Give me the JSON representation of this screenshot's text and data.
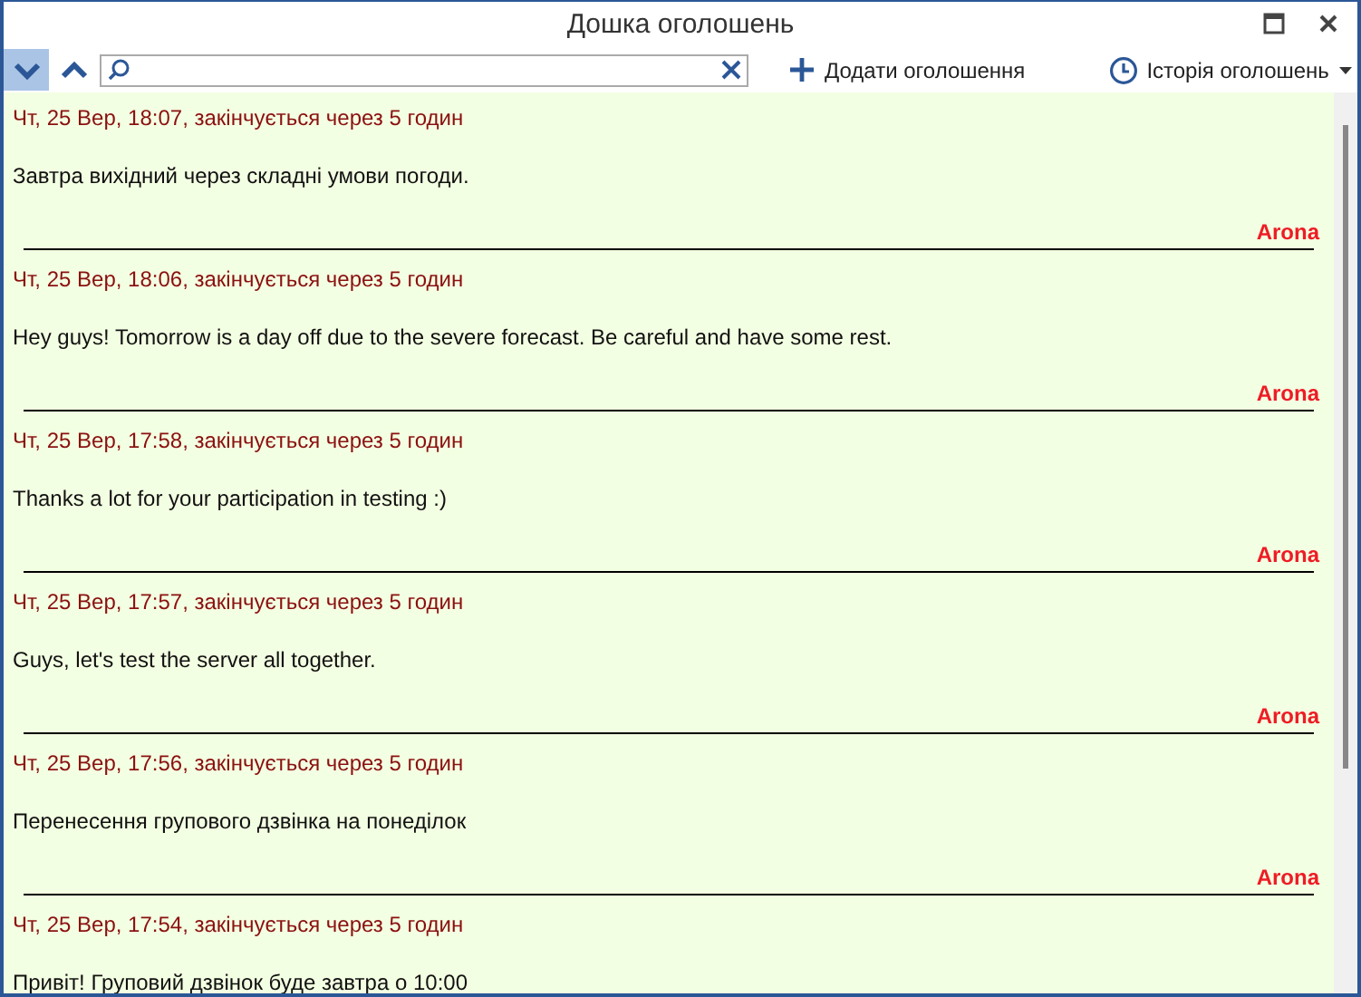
{
  "window": {
    "title": "Дошка оголошень"
  },
  "toolbar": {
    "add_button": "Додати оголошення",
    "history_button": "Історія оголошень",
    "expand_selected": true
  },
  "messages": [
    {
      "header": "Чт, 25 Вер, 18:07, закінчується через 5 годин",
      "text": "Завтра вихідний через складні умови погоди.",
      "author": "Arona"
    },
    {
      "header": "Чт, 25 Вер, 18:06, закінчується через 5 годин",
      "text": "Hey guys! Tomorrow is a day off due to the severe forecast. Be careful and have some rest.",
      "author": "Arona"
    },
    {
      "header": "Чт, 25 Вер, 17:58, закінчується через 5 годин",
      "text": "Thanks a lot for your participation in testing :)",
      "author": "Arona"
    },
    {
      "header": "Чт, 25 Вер, 17:57, закінчується через 5 годин",
      "text": "Guys, let's test the server all together.",
      "author": "Arona"
    },
    {
      "header": "Чт, 25 Вер, 17:56, закінчується через 5 годин",
      "text": "Перенесення групового дзвінка на понеділок",
      "author": "Arona"
    },
    {
      "header": "Чт, 25 Вер, 17:54, закінчується через 5 годин",
      "text": "Привіт! Груповий дзвінок буде завтра о 10:00"
    }
  ]
}
